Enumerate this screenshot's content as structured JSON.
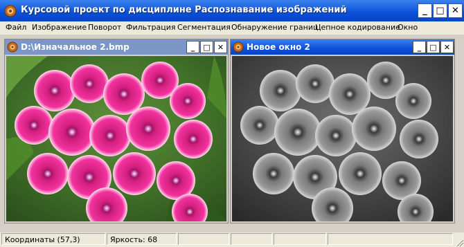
{
  "app": {
    "title": "Курсовой проект по дисциплине Распознавание изображений",
    "icon": "app-icon",
    "controls": {
      "minimize": "_",
      "maximize": "□",
      "close": "✕"
    }
  },
  "menu": {
    "items": [
      "Файл",
      "Изображение",
      "Поворот",
      "Фильтрация",
      "Сегментация",
      "Обнаружение границ",
      "Цепное кодирование",
      "Окно"
    ]
  },
  "windows": [
    {
      "title": "D:\\Изначальное 2.bmp",
      "active": false,
      "image": "pink-sweet-william-flowers-photo"
    },
    {
      "title": "Новое окно 2",
      "active": true,
      "image": "grayscale-flowers-photo"
    }
  ],
  "status": {
    "coordinates": "Координаты (57,3)",
    "brightness": "Яркость: 68"
  },
  "colors": {
    "titlebar_active": "#0a4fd6",
    "titlebar_inactive": "#7b96c7",
    "flower_pink": "#e8289a",
    "flower_center": "#f7e6ff"
  }
}
